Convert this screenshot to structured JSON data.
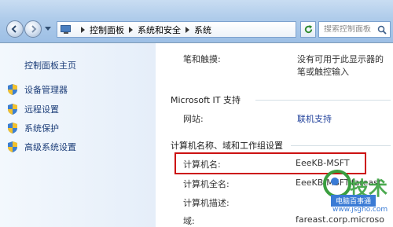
{
  "address_bar": {
    "crumbs": [
      "控制面板",
      "系统和安全",
      "系统"
    ],
    "search_placeholder": "搜索控制面板"
  },
  "left_nav": {
    "home": "控制面板主页",
    "items": [
      {
        "label": "设备管理器"
      },
      {
        "label": "远程设置"
      },
      {
        "label": "系统保护"
      },
      {
        "label": "高级系统设置"
      }
    ]
  },
  "main": {
    "pen_touch": {
      "label": "笔和触摸:",
      "value_line1": "没有可用于此显示器的",
      "value_line2": "笔或触控输入"
    },
    "support_header": "Microsoft IT 支持",
    "website": {
      "label": "网站:",
      "value": "联机支持"
    },
    "computer_header": "计算机名称、域和工作组设置",
    "rows": [
      {
        "label": "计算机名:",
        "value": "EeeKB-MSFT"
      },
      {
        "label": "计算机全名:",
        "value": "EeeKB-MSFT.fareast"
      },
      {
        "label": "计算机描述:",
        "value": ""
      },
      {
        "label": "域:",
        "value": "fareast.corp.microso"
      }
    ]
  },
  "watermark": {
    "big": "技术",
    "tag": "电脑百事通",
    "url": "www.jsgho.com"
  },
  "colors": {
    "highlight_border": "#cc1111",
    "link": "#1e3f9a",
    "watermark_green": "#3aa13f"
  }
}
